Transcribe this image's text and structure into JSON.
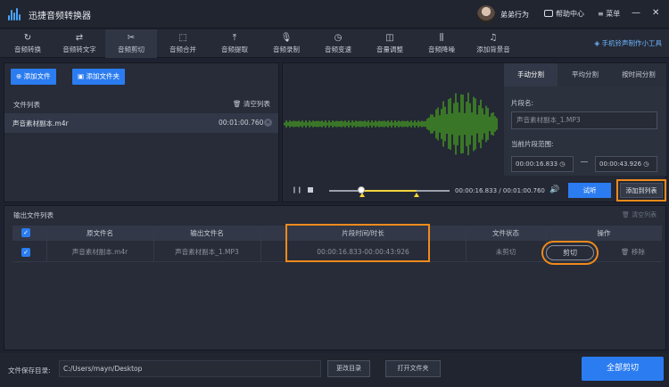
{
  "app": {
    "title": "迅捷音频转换器",
    "username": "弟弟行为",
    "help_label": "帮助中心",
    "menu_label": "菜单",
    "win_min": "—",
    "win_close": "✕"
  },
  "toolbar": {
    "items": [
      {
        "label": "音频转换",
        "icon": "↻"
      },
      {
        "label": "音频转文字",
        "icon": "⇄"
      },
      {
        "label": "音频剪切",
        "icon": "✂"
      },
      {
        "label": "音频合并",
        "icon": "⬚"
      },
      {
        "label": "音频提取",
        "icon": "⤒"
      },
      {
        "label": "音频录制",
        "icon": "🎙"
      },
      {
        "label": "音频变速",
        "icon": "◷"
      },
      {
        "label": "音量调整",
        "icon": "◫"
      },
      {
        "label": "音频降噪",
        "icon": "⫼"
      },
      {
        "label": "添加背景音",
        "icon": "♫"
      }
    ],
    "active_index": 2,
    "ringtone_link": "手机铃声制作小工具"
  },
  "files": {
    "add_file": "添加文件",
    "add_folder": "添加文件夹",
    "list_label": "文件列表",
    "clear_list": "清空列表",
    "items": [
      {
        "name": "声音素材副本.m4r",
        "duration": "00:01:00.760"
      }
    ]
  },
  "player": {
    "current": "00:00:16.833",
    "separator": "/",
    "total": "00:01:00.760",
    "selection_start_fraction": 0.277,
    "selection_end_fraction": 0.72,
    "preview_label": "试听",
    "add_to_list_label": "添加到列表"
  },
  "split": {
    "tabs": [
      "手动分割",
      "平均分割",
      "按时间分割"
    ],
    "active_tab": 0,
    "segment_name_label": "片段名:",
    "segment_name_placeholder": "声音素材副本_1.MP3",
    "range_label": "当前片段范围:",
    "range_start": "00:00:16.833",
    "range_end": "00:00:43.926"
  },
  "output": {
    "title": "输出文件列表",
    "clear_label": "清空列表",
    "columns": [
      "原文件名",
      "输出文件名",
      "片段时间/时长",
      "文件状态",
      "操作"
    ],
    "rows": [
      {
        "source": "声音素材副本.m4r",
        "output": "声音素材副本_1.MP3",
        "segment": "00:00:16.833-00:00:43:926",
        "status": "未剪切",
        "cut_label": "剪切",
        "remove_label": "移除"
      }
    ]
  },
  "footer": {
    "save_dir_label": "文件保存目录:",
    "save_dir": "C:/Users/mayn/Desktop",
    "change_dir": "更改目录",
    "open_folder": "打开文件夹",
    "cut_all": "全部剪切"
  },
  "colors": {
    "accent": "#2b7cf0",
    "highlight": "#f08a1c",
    "wave": "#52c41a",
    "selection": "#f4d43c"
  }
}
